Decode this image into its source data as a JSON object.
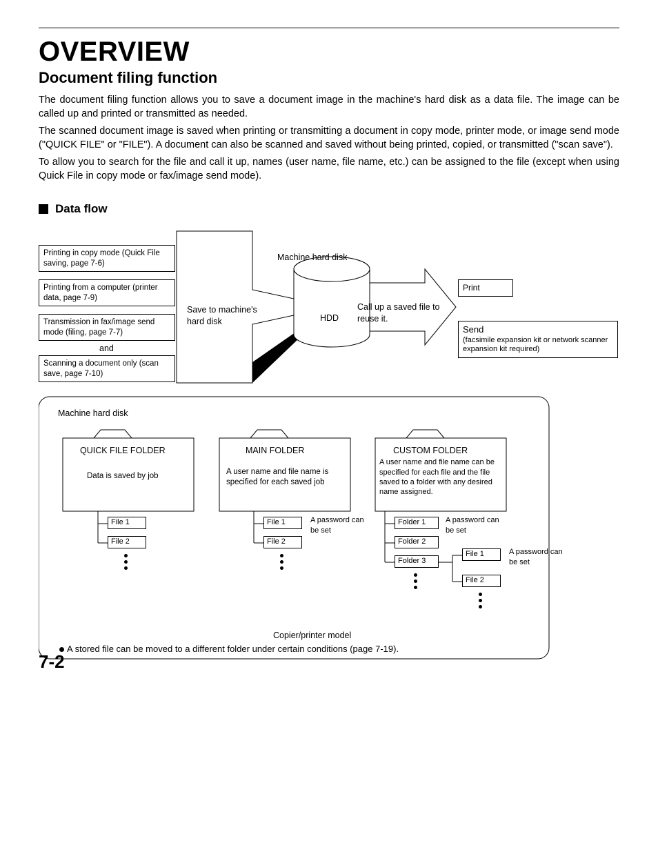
{
  "title": "OVERVIEW",
  "subtitle": "Document filing function",
  "paragraphs": {
    "p1": "The document filing function allows you to save a document image in the machine's hard disk as a data file. The image can be called up and printed or transmitted as needed.",
    "p2": "The scanned document image is saved when printing or transmitting a document in copy mode, printer mode, or image send mode (\"QUICK FILE\" or \"FILE\"). A document can also be scanned and saved without being printed, copied, or transmitted (\"scan save\").",
    "p3": "To allow you to search for the file and call it up, names (user name, file name, etc.) can be assigned to the file (except when using Quick File in copy mode or fax/image send mode)."
  },
  "section_head": "Data flow",
  "flow": {
    "in1": "Printing in copy mode (Quick File saving, page 7-6)",
    "in2": "Printing from a computer (printer data, page 7-9)",
    "in3": "Transmission in fax/image send mode (filing, page 7-7)",
    "and": "and",
    "in4": "Scanning a document only (scan save, page 7-10)",
    "save_label": "Save to machine's hard disk",
    "hdd_top": "Machine hard disk",
    "hdd": "HDD",
    "call_label": "Call up a saved file to reuse it.",
    "print": "Print",
    "send": "Send",
    "send_note": "(facsimile expansion kit or network scanner expansion kit required)"
  },
  "disk": {
    "title": "Machine hard disk",
    "quick": {
      "hd": "QUICK FILE FOLDER",
      "desc": "Data is saved by job",
      "f1": "File 1",
      "f2": "File 2"
    },
    "main": {
      "hd": "MAIN FOLDER",
      "desc": "A user name and file name is specified for each saved job",
      "f1": "File 1",
      "f2": "File 2",
      "pw": "A password can be set"
    },
    "custom": {
      "hd": "CUSTOM FOLDER",
      "desc": "A user name and file name can be specified for each file and the file saved to a folder with any desired name assigned.",
      "fd1": "Folder 1",
      "fd2": "Folder 2",
      "fd3": "Folder 3",
      "pw1": "A password can be set",
      "f1": "File 1",
      "f2": "File 2",
      "pw2": "A password can be set"
    },
    "model": "Copier/printer model",
    "note": "A stored file can be moved to a different folder under certain conditions (page 7-19)."
  },
  "page_number": "7-2"
}
